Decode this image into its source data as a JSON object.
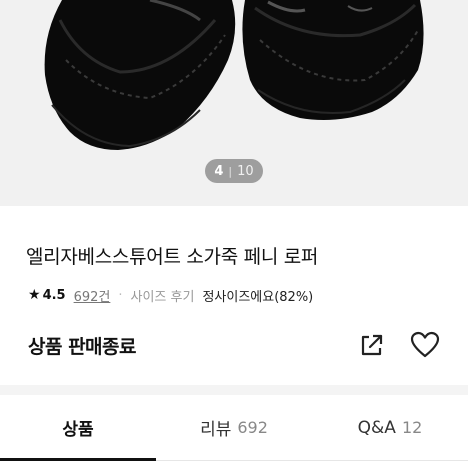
{
  "gallery": {
    "current": "4",
    "separator": "|",
    "total": "10"
  },
  "product": {
    "title": "엘리자베스스튜어트 소가죽 페니 로퍼",
    "rating_icon": "star-icon",
    "rating": "4.5",
    "review_count": "692건",
    "separator": "·",
    "size_review_label": "사이즈 후기",
    "size_review_value": "정사이즈에요(82%)",
    "status": "상품 판매종료"
  },
  "actions": {
    "share_icon": "share-icon",
    "wishlist_icon": "heart-icon"
  },
  "tabs": [
    {
      "label": "상품",
      "count": ""
    },
    {
      "label": "리뷰",
      "count": "692"
    },
    {
      "label": "Q&A",
      "count": "12"
    }
  ],
  "colors": {
    "gallery_bg": "#f1f1f1",
    "text": "#111111",
    "muted": "#888888",
    "active_tab_underline": "#111111"
  }
}
